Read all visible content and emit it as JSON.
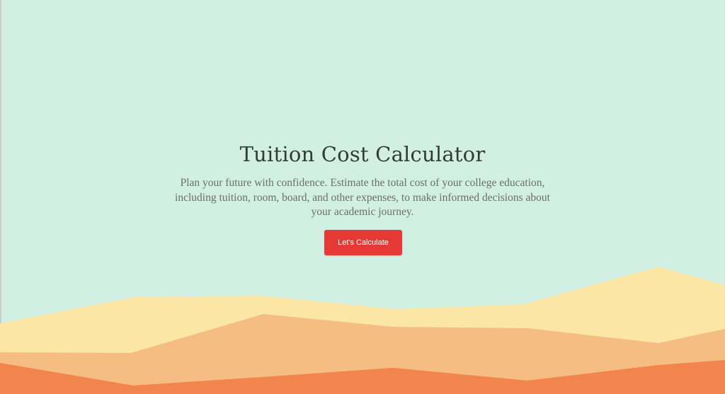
{
  "hero": {
    "title": "Tuition Cost Calculator",
    "subtitle": "Plan your future with confidence. Estimate the total cost of your college education, including tuition, room, board, and other expenses, to make informed decisions about your academic journey.",
    "cta_label": "Let's Calculate"
  },
  "colors": {
    "background": "#d1efe3",
    "button": "#e53935",
    "hill_back": "#fbe6a6",
    "hill_middle": "#f6bd82",
    "hill_front": "#f2844e"
  }
}
